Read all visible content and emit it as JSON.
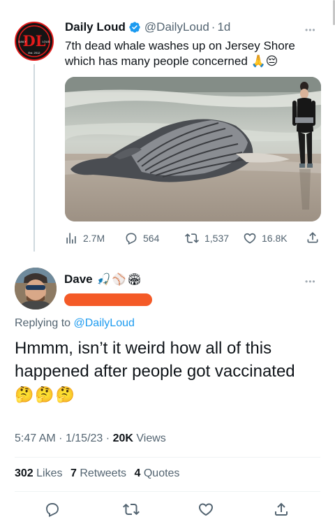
{
  "tweet": {
    "author_name": "Daily Loud",
    "handle": "@DailyLoud",
    "age": "1d",
    "separator": "·",
    "text_line1": "7th dead whale washes up on Jersey Shore",
    "text_line2": "which has many people concerned",
    "emoji": "🙏😔",
    "more": "•••",
    "avatar": {
      "monogram": "DL",
      "left_word": "DAILY",
      "right_word": "LOUD",
      "est": "Est. 2012"
    },
    "stats": {
      "views": "2.7M",
      "replies": "564",
      "retweets": "1,537",
      "likes": "16.8K"
    }
  },
  "reply": {
    "author_name": "Dave",
    "author_emoji": "🎣⚾🏟",
    "replying_label": "Replying to",
    "replying_handle": "@DailyLoud",
    "text_line1": "Hmmm, isn’t it weird how all of this",
    "text_line2": "happened after people got vaccinated",
    "emoji": "🤔🤔🤔",
    "more": "•••",
    "time": "5:47 AM",
    "date": "1/15/23",
    "views_count": "20K",
    "views_label": "Views",
    "sep": "·",
    "likes_count": "302",
    "likes_label": "Likes",
    "retweets_count": "7",
    "retweets_label": "Retweets",
    "quotes_count": "4",
    "quotes_label": "Quotes"
  },
  "colors": {
    "accent": "#1d9bf0",
    "secondary_text": "#536471",
    "redaction": "#f45a27",
    "verified": "#1d9bf0"
  },
  "icons": [
    "views-icon",
    "reply-icon",
    "retweet-icon",
    "like-icon",
    "share-icon",
    "verified-badge-icon"
  ]
}
